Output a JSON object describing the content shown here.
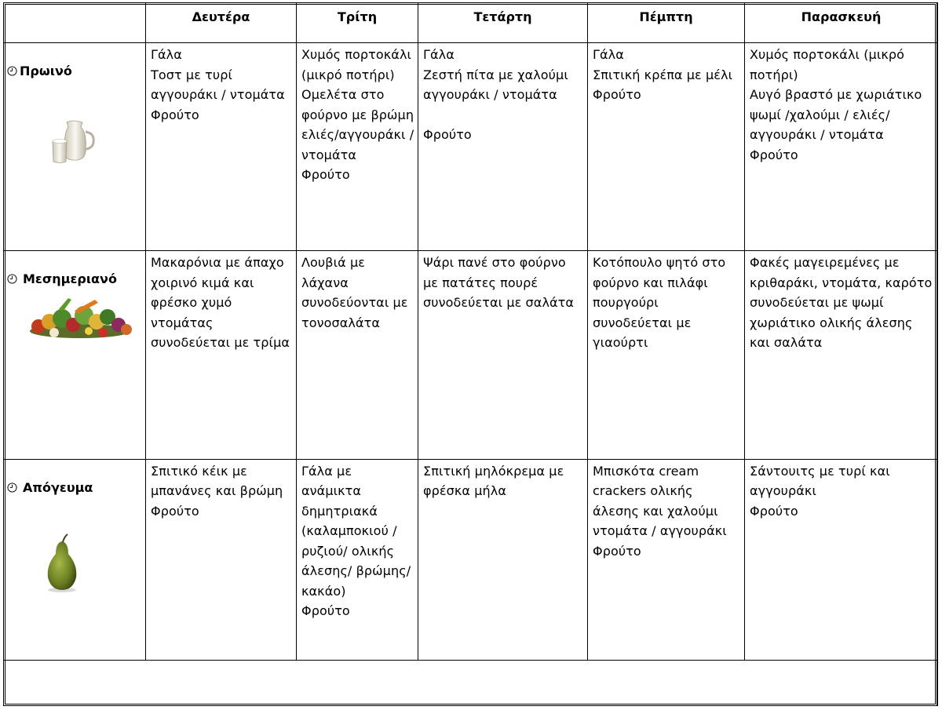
{
  "days": [
    "Δευτέρα",
    "Τρίτη",
    "Τετάρτη",
    "Πέμπτη",
    "Παρασκευή"
  ],
  "meals": [
    {
      "label": "Πρωινό",
      "icon": "milk-jug-icon",
      "cells": [
        "Γάλα\nΤοστ με τυρί αγγουράκι / ντομάτα\nΦρούτο",
        "Χυμός πορτοκάλι (μικρό ποτήρι)\nΟμελέτα στο φούρνο με βρώμη ελιές/αγγουράκι / ντομάτα\nΦρούτο",
        "Γάλα\nΖεστή πίτα με χαλούμι αγγουράκι / ντομάτα\n\nΦρούτο",
        "Γάλα\nΣπιτική κρέπα με μέλι\nΦρούτο",
        "Χυμός πορτοκάλι (μικρό ποτήρι)\nΑυγό βραστό με χωριάτικο ψωμί /χαλούμι / ελιές/αγγουράκι / ντομάτα\nΦρούτο"
      ]
    },
    {
      "label": "Μεσημεριανό",
      "icon": "vegetables-icon",
      "cells": [
        "Μακαρόνια με άπαχο χοιρινό κιμά και φρέσκο χυμό ντομάτας συνοδεύεται με τρίμα",
        "Λουβιά με λάχανα συνοδεύονται με τονοσαλάτα",
        "Ψάρι πανέ στο φούρνο με πατάτες πουρέ συνοδεύεται με σαλάτα",
        "Κοτόπουλο ψητό στο φούρνο και πιλάφι πουργούρι συνοδεύεται με γιαούρτι",
        "Φακές μαγειρεμένες με κριθαράκι, ντομάτα, καρότο συνοδεύεται με ψωμί χωριάτικο ολικής άλεσης και σαλάτα"
      ]
    },
    {
      "label": "Απόγευμα",
      "icon": "pear-icon",
      "cells": [
        "Σπιτικό κέικ με μπανάνες και βρώμη\nΦρούτο",
        "Γάλα με ανάμικτα δημητριακά (καλαμποκιού /ρυζιού/ ολικής άλεσης/ βρώμης/κακάο)\nΦρούτο",
        "Σπιτική μηλόκρεμα με φρέσκα μήλα",
        "Μπισκότα  cream crackers ολικής άλεσης και χαλούμι ντομάτα / αγγουράκι\nΦρούτο",
        "Σάντουιτς με τυρί και αγγουράκι\nΦρούτο"
      ]
    }
  ]
}
